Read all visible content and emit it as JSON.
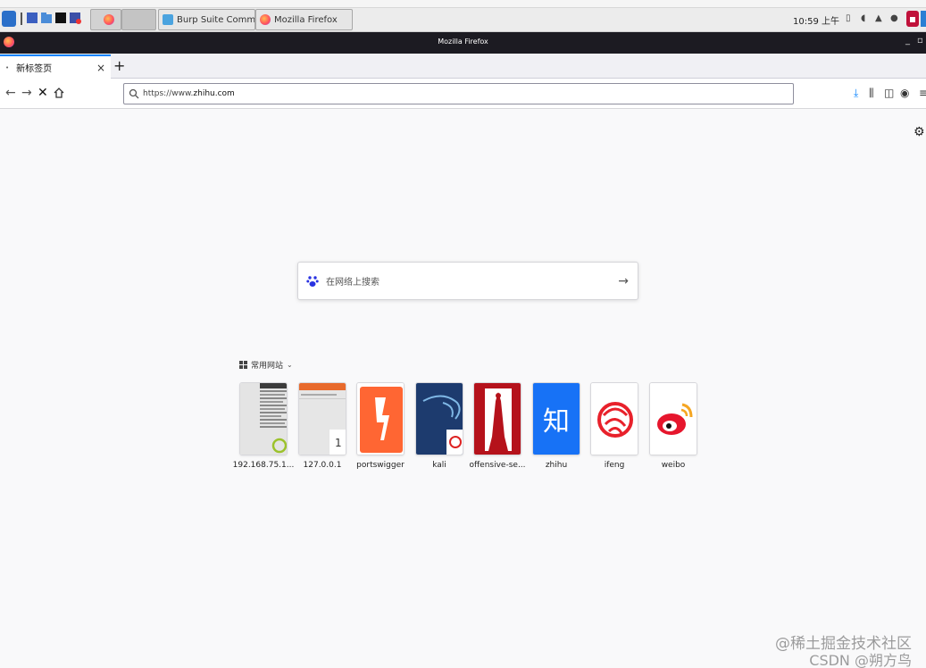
{
  "taskbar": {
    "windows": [
      {
        "label": "Burp Suite Community E..."
      },
      {
        "label": "Mozilla Firefox"
      }
    ],
    "clock": "10:59 上午"
  },
  "window": {
    "title": "Mozilla Firefox"
  },
  "tabs": [
    {
      "label": "新标签页"
    }
  ],
  "navbar": {
    "url_scheme": "https://www.",
    "url_host": "zhihu.com"
  },
  "search": {
    "placeholder": "在网络上搜索"
  },
  "top_sites": {
    "header": "常用网站",
    "tiles": [
      {
        "label": "192.168.75.1..."
      },
      {
        "label": "127.0.0.1",
        "badge": "1"
      },
      {
        "label": "portswigger"
      },
      {
        "label": "kali"
      },
      {
        "label": "offensive-se..."
      },
      {
        "label": "zhihu",
        "glyph": "知"
      },
      {
        "label": "ifeng"
      },
      {
        "label": "weibo"
      }
    ]
  },
  "watermark": {
    "line1": "@稀土掘金技术社区",
    "line2": "CSDN @朔方鸟"
  },
  "colors": {
    "tab_accent": "#0a84ff",
    "titlebar": "#1c1b22",
    "portswigger": "#ff6633",
    "kali": "#1d3b6e",
    "offensive": "#b5121b",
    "zhihu": "#1772f6",
    "weibo": "#e6162d"
  }
}
